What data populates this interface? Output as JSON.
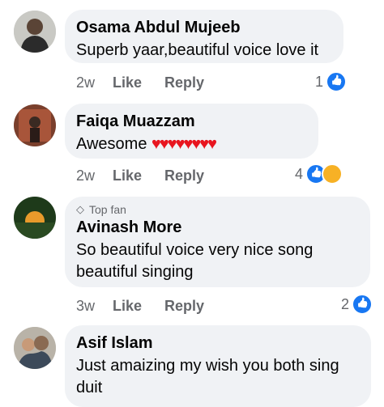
{
  "comments": [
    {
      "name": "Osama Abdul Mujeeb",
      "text": "Superb yaar,beautiful voice love it",
      "time": "2w",
      "like_label": "Like",
      "reply_label": "Reply",
      "reaction_count": "1",
      "reactions": [
        "like-icon"
      ]
    },
    {
      "name": "Faiqa Muazzam",
      "text": "Awesome",
      "emoji": "♥♥♥♥♥♥♥♥",
      "time": "2w",
      "like_label": "Like",
      "reply_label": "Reply",
      "reaction_count": "4",
      "reactions": [
        "like-icon",
        "care-icon"
      ]
    },
    {
      "badge": "Top fan",
      "name": "Avinash More",
      "text": "So beautiful voice very nice song beautiful singing",
      "time": "3w",
      "like_label": "Like",
      "reply_label": "Reply",
      "reaction_count": "2",
      "reactions": [
        "like-icon"
      ]
    },
    {
      "name": "Asif Islam",
      "text": "Just amaizing my wish you both sing duit"
    }
  ],
  "colors": {
    "bubble": "#f0f2f5",
    "meta": "#65676b",
    "like_blue": "#1877f2",
    "heart_red": "#e8151f"
  }
}
